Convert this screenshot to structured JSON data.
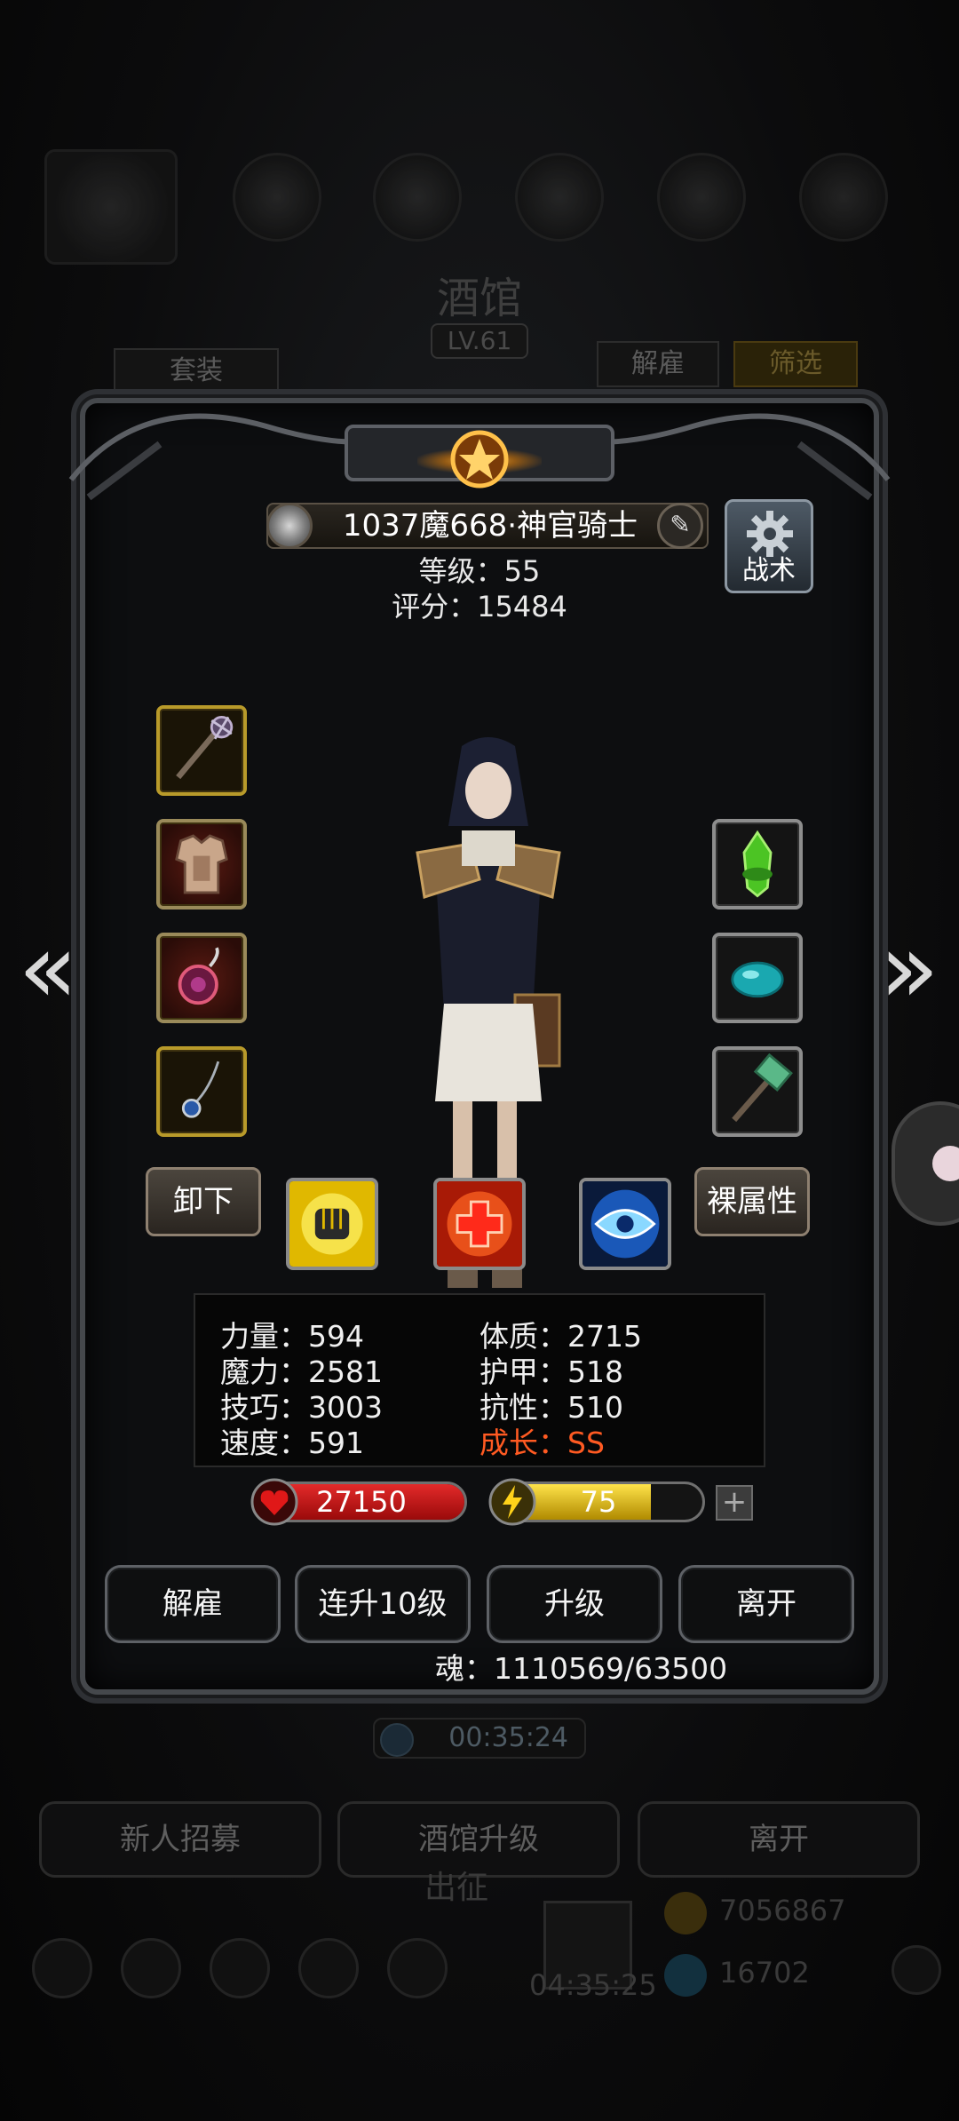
{
  "background": {
    "title": "酒馆",
    "level": "LV.61",
    "tab_left": "套装",
    "tab_dismiss": "解雇",
    "tab_filter": "筛选",
    "timer": "00:35:24",
    "buttons": [
      "新人招募",
      "酒馆升级",
      "离开"
    ],
    "expedition": "出征",
    "gold": "7056867",
    "gems": "16702",
    "bottom_timer": "04:35:25"
  },
  "hero": {
    "name": "1037魔668·神官骑士",
    "level_text": "等级：55",
    "score_text": "评分：15484",
    "tactic_label": "战术"
  },
  "equipment": {
    "left": [
      "mace-icon",
      "armor-icon",
      "amulet-icon",
      "necklace-icon"
    ],
    "right": [
      "green-crystal-icon",
      "cyan-gem-icon",
      "jade-hammer-icon"
    ]
  },
  "actions": {
    "unequip": "卸下",
    "bare_attributes": "裸属性"
  },
  "skills": [
    "fist-icon",
    "heal-cross-icon",
    "eye-icon"
  ],
  "attributes": {
    "strength": "力量：594",
    "magic": "魔力：2581",
    "skill": "技巧：3003",
    "speed": "速度：591",
    "constitution": "体质：2715",
    "armor": "护甲：518",
    "resistance": "抗性：510",
    "growth": "成长：SS"
  },
  "bars": {
    "hp": "27150",
    "energy": "75",
    "energy_fill_fraction": 0.75,
    "plus": "+"
  },
  "bottom_actions": {
    "dismiss": "解雇",
    "upgrade10": "连升10级",
    "upgrade": "升级",
    "leave": "离开"
  },
  "soul": "魂：1110569/63500",
  "colors": {
    "hp_red": "#c4141a",
    "energy_yellow": "#d9b300",
    "growth_orange": "#ff5a22",
    "gold_border": "#b89a2a"
  }
}
